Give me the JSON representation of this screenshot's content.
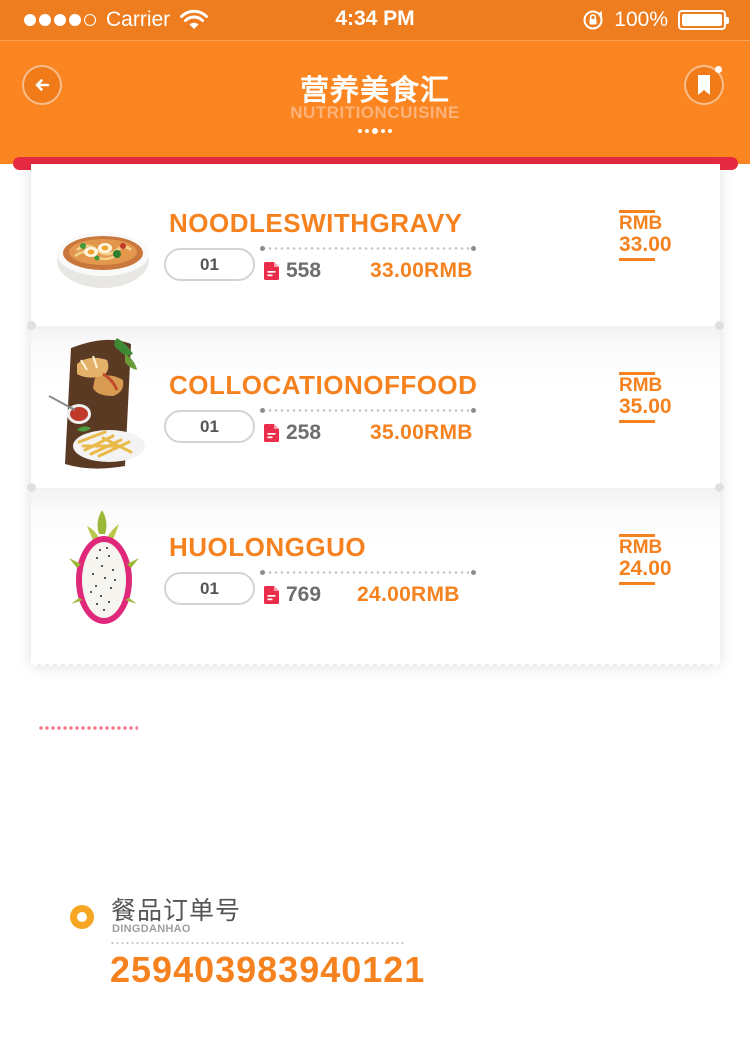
{
  "status_bar": {
    "carrier": "Carrier",
    "time": "4:34 PM",
    "battery": "100%",
    "signal_bars": 4
  },
  "header": {
    "title_cn": "营养美食汇",
    "title_en": "NUTRITIONCUISINE",
    "back_icon": "back-arrow-icon",
    "bookmark_icon": "bookmark-icon"
  },
  "colors": {
    "primary": "#fb8520",
    "accent_red": "#e72a41",
    "text_orange": "#f5821f"
  },
  "items": [
    {
      "name": "NOODLESWITHGRAVY",
      "qty": "01",
      "count": "558",
      "subtotal": "33.00RMB",
      "currency": "RMB",
      "price": "33.00",
      "image": "noodle-bowl-image"
    },
    {
      "name": "COLLOCATIONOFFOOD",
      "qty": "01",
      "count": "258",
      "subtotal": "35.00RMB",
      "currency": "RMB",
      "price": "35.00",
      "image": "meal-platter-image"
    },
    {
      "name": "HUOLONGGUO",
      "qty": "01",
      "count": "769",
      "subtotal": "24.00RMB",
      "currency": "RMB",
      "price": "24.00",
      "image": "dragon-fruit-image"
    }
  ],
  "order": {
    "label_cn": "餐品订单号",
    "label_en": "DINGDANHAO",
    "number": "25940398394012​1"
  }
}
